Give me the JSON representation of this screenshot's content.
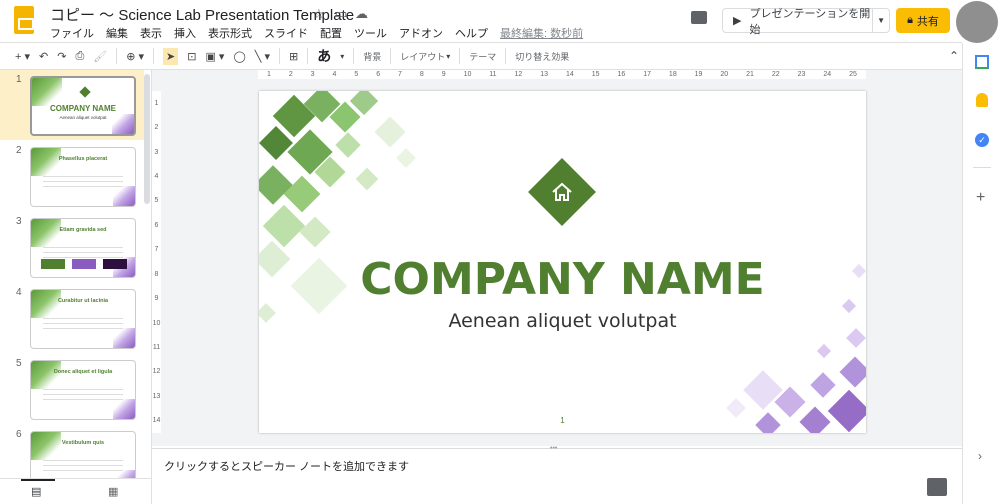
{
  "header": {
    "title": "コピー 〜 Science Lab Presentation Template",
    "menu": [
      "ファイル",
      "編集",
      "表示",
      "挿入",
      "表示形式",
      "スライド",
      "配置",
      "ツール",
      "アドオン",
      "ヘルプ"
    ],
    "last_edit": "最終編集: 数秒前",
    "present_label": "プレゼンテーションを開始",
    "share_label": "共有"
  },
  "toolbar": {
    "background": "背景",
    "layout": "レイアウト",
    "theme": "テーマ",
    "transition": "切り替え効果",
    "ime": "あ"
  },
  "ruler": {
    "h": [
      "1",
      "2",
      "3",
      "4",
      "5",
      "6",
      "7",
      "8",
      "9",
      "10",
      "11",
      "12",
      "13",
      "14",
      "15",
      "16",
      "17",
      "18",
      "19",
      "20",
      "21",
      "22",
      "23",
      "24",
      "25"
    ],
    "v": [
      "1",
      "2",
      "3",
      "4",
      "5",
      "6",
      "7",
      "8",
      "9",
      "10",
      "11",
      "12",
      "13",
      "14"
    ]
  },
  "slides": [
    {
      "num": "1",
      "title": "COMPANY NAME",
      "subtitle": "Aenean aliquet volutpat"
    },
    {
      "num": "2",
      "title": "Phasellus placerat"
    },
    {
      "num": "3",
      "title": "Etiam gravida sed"
    },
    {
      "num": "4",
      "title": "Curabitur ut lacinia"
    },
    {
      "num": "5",
      "title": "Donec aliquet et ligula"
    },
    {
      "num": "6",
      "title": "Vestibulum quis"
    }
  ],
  "main_slide": {
    "title": "COMPANY NAME",
    "subtitle": "Aenean aliquet volutpat",
    "page": "1"
  },
  "notes": {
    "placeholder": "クリックするとスピーカー ノートを追加できます"
  },
  "colors": {
    "brand_green": "#4f7f2f",
    "accent_purple": "#8a5cc0",
    "share_yellow": "#fbbc04"
  }
}
